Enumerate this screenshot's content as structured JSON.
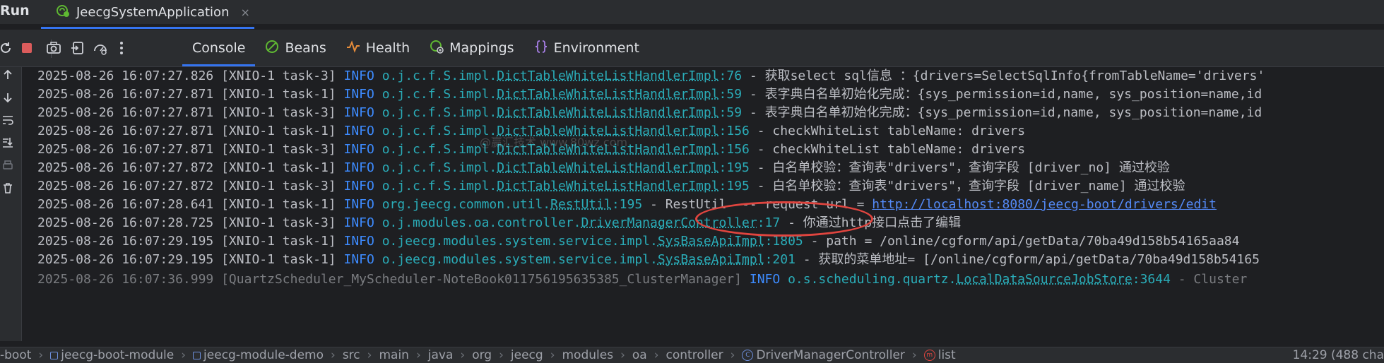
{
  "run": {
    "label": "Run",
    "tab_title": "JeecgSystemApplication",
    "tab_close": "×"
  },
  "toolbar": {
    "tabs": [
      {
        "label": "Console",
        "icon": "console",
        "active": true
      },
      {
        "label": "Beans",
        "icon": "beans-icon"
      },
      {
        "label": "Health",
        "icon": "health-icon"
      },
      {
        "label": "Mappings",
        "icon": "mappings-icon"
      },
      {
        "label": "Environment",
        "icon": "environment-icon"
      }
    ]
  },
  "console": {
    "watermark": "@赢汇技术 www.80wz.com",
    "lines": [
      {
        "ts": "2025-08-26 16:07:27.826",
        "thread": "[XNIO-1 task-3]",
        "level": "INFO",
        "pkg": "o.j.c.f.S.impl.",
        "cls": "DictTableWhiteListHandlerImpl",
        "loc": ":76",
        "msg": " - 获取select sql信息 ：{drivers=SelectSqlInfo{fromTableName='drivers'"
      },
      {
        "ts": "2025-08-26 16:07:27.871",
        "thread": "[XNIO-1 task-1]",
        "level": "INFO",
        "pkg": "o.j.c.f.S.impl.",
        "cls": "DictTableWhiteListHandlerImpl",
        "loc": ":59",
        "msg": " - 表字典白名单初始化完成：{sys_permission=id,name, sys_position=name,id"
      },
      {
        "ts": "2025-08-26 16:07:27.871",
        "thread": "[XNIO-1 task-3]",
        "level": "INFO",
        "pkg": "o.j.c.f.S.impl.",
        "cls": "DictTableWhiteListHandlerImpl",
        "loc": ":59",
        "msg": " - 表字典白名单初始化完成：{sys_permission=id,name, sys_position=name,id"
      },
      {
        "ts": "2025-08-26 16:07:27.871",
        "thread": "[XNIO-1 task-1]",
        "level": "INFO",
        "pkg": "o.j.c.f.S.impl.",
        "cls": "DictTableWhiteListHandlerImpl",
        "loc": ":156",
        "msg": " - checkWhiteList tableName: drivers"
      },
      {
        "ts": "2025-08-26 16:07:27.871",
        "thread": "[XNIO-1 task-3]",
        "level": "INFO",
        "pkg": "o.j.c.f.S.impl.",
        "cls": "DictTableWhiteListHandlerImpl",
        "loc": ":156",
        "msg": " - checkWhiteList tableName: drivers"
      },
      {
        "ts": "2025-08-26 16:07:27.872",
        "thread": "[XNIO-1 task-1]",
        "level": "INFO",
        "pkg": "o.j.c.f.S.impl.",
        "cls": "DictTableWhiteListHandlerImpl",
        "loc": ":195",
        "msg": " - 白名单校验：查询表\"drivers\"，查询字段 [driver_no] 通过校验"
      },
      {
        "ts": "2025-08-26 16:07:27.872",
        "thread": "[XNIO-1 task-3]",
        "level": "INFO",
        "pkg": "o.j.c.f.S.impl.",
        "cls": "DictTableWhiteListHandlerImpl",
        "loc": ":195",
        "msg": " - 白名单校验：查询表\"drivers\"，查询字段 [driver_name] 通过校验"
      },
      {
        "ts": "2025-08-26 16:07:28.641",
        "thread": "[XNIO-1 task-1]",
        "level": "INFO",
        "pkg": "org.jeecg.common.util.",
        "cls": "RestUtil",
        "loc": ":195",
        "msg": " -  RestUtil  --- request    url = ",
        "url": "http://localhost:8080/jeecg-boot/drivers/edit"
      },
      {
        "ts": "2025-08-26 16:07:28.725",
        "thread": "[XNIO-1 task-3]",
        "level": "INFO",
        "pkg": "o.j.modules.oa.controller.",
        "cls": "DriverManagerController",
        "loc": ":17",
        "msg": " - 你通过http接口点击了编辑"
      },
      {
        "ts": "2025-08-26 16:07:29.195",
        "thread": "[XNIO-1 task-1]",
        "level": "INFO",
        "pkg": "o.jeecg.modules.system.service.impl.",
        "cls": "SysBaseApiImpl",
        "loc": ":1805",
        "msg": " -  path = /online/cgform/api/getData/70ba49d158b54165aa84"
      },
      {
        "ts": "2025-08-26 16:07:29.195",
        "thread": "[XNIO-1 task-1]",
        "level": "INFO",
        "pkg": "o.jeecg.modules.system.service.impl.",
        "cls": "SysBaseApiImpl",
        "loc": ":201",
        "msg": " - 获取的菜单地址= [/online/cgform/api/getData/70ba49d158b54165"
      },
      {
        "ts": "2025-08-26 16:07:36.999",
        "thread": "[QuartzScheduler_MyScheduler-NoteBook011756195635385_ClusterManager]",
        "level": "INFO",
        "pkg": "o.s.scheduling.quartz.",
        "cls": "LocalDataSourceJobStore",
        "loc": ":3644",
        "msg": " - Cluster"
      }
    ]
  },
  "status": {
    "breadcrumbs": [
      {
        "label": "-boot",
        "icon": ""
      },
      {
        "label": "jeecg-boot-module",
        "icon": "module"
      },
      {
        "label": "jeecg-module-demo",
        "icon": "module"
      },
      {
        "label": "src",
        "icon": ""
      },
      {
        "label": "main",
        "icon": ""
      },
      {
        "label": "java",
        "icon": ""
      },
      {
        "label": "org",
        "icon": ""
      },
      {
        "label": "jeecg",
        "icon": ""
      },
      {
        "label": "modules",
        "icon": ""
      },
      {
        "label": "oa",
        "icon": ""
      },
      {
        "label": "controller",
        "icon": ""
      },
      {
        "label": "DriverManagerController",
        "icon": "class"
      },
      {
        "label": "list",
        "icon": "method"
      }
    ],
    "separator": "›",
    "position": "14:29 (488 cha"
  },
  "colors": {
    "accent": "#3574f0",
    "info_level": "#3d8bff",
    "logger": "#2aacb8",
    "highlight_oval": "#e0453f"
  }
}
